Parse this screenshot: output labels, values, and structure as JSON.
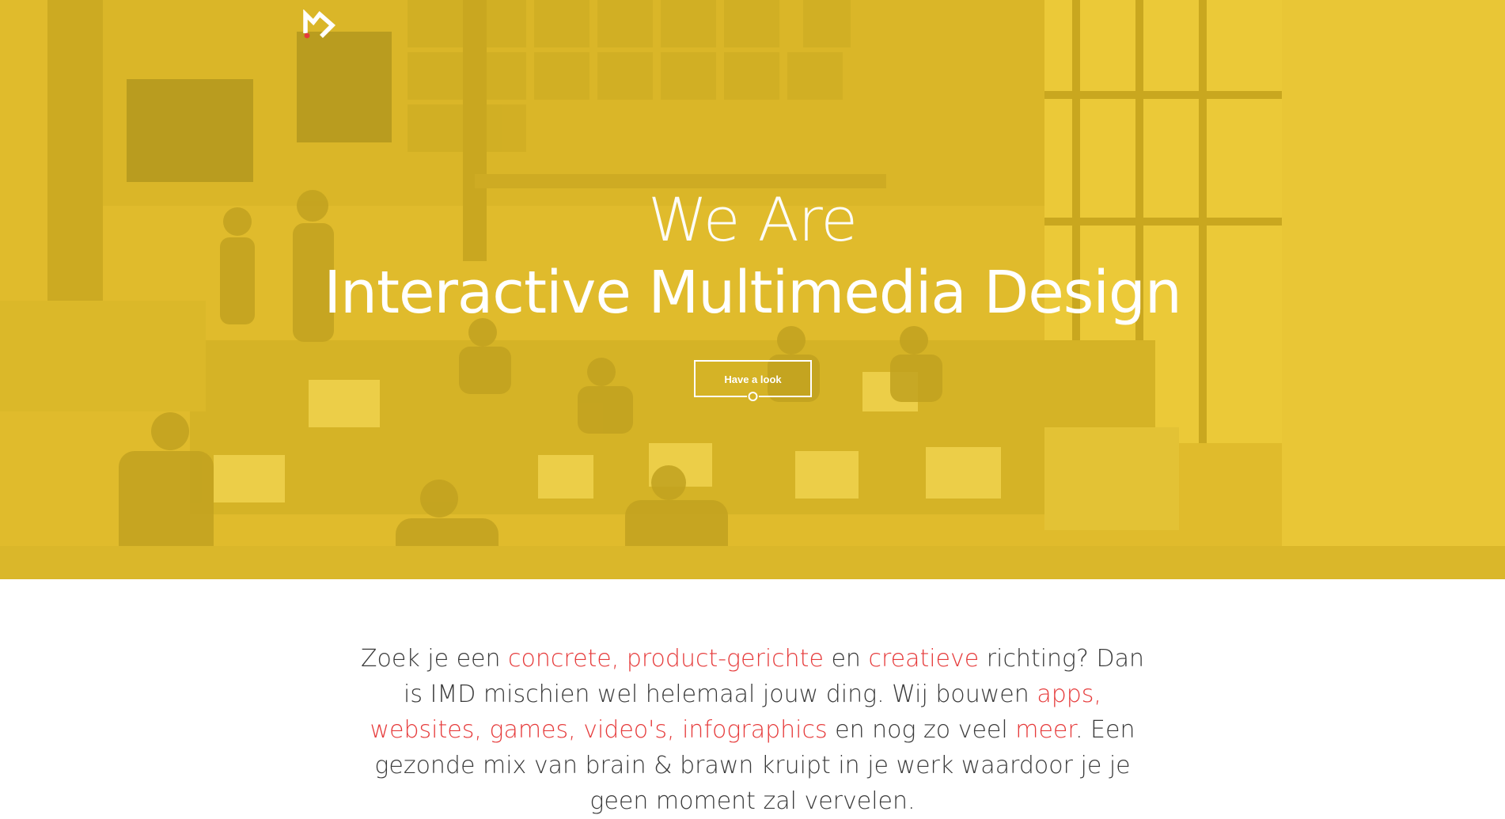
{
  "hero": {
    "kicker": "We Are",
    "title": "Interactive Multimedia Design",
    "cta_label": "Have a look"
  },
  "intro": {
    "parts": [
      "Zoek je een ",
      "concrete, product-gerichte",
      " en ",
      "creatieve",
      " richting? Dan is IMD mischien wel helemaal jouw ding. Wij bouwen ",
      "apps, websites, games, video's, infographics",
      " en nog zo veel ",
      "meer",
      ". Een gezonde mix van brain & brawn kruipt in je werk waardoor je je geen moment zal vervelen."
    ]
  },
  "colors": {
    "hero_tint": "#f0cc34",
    "accent": "#e63b3b",
    "body_text": "#3a3a3a",
    "logo_dot": "#e63b3b"
  },
  "icons": {
    "logo": "imd-m-logo",
    "cta_indicator": "circle-indicator"
  }
}
